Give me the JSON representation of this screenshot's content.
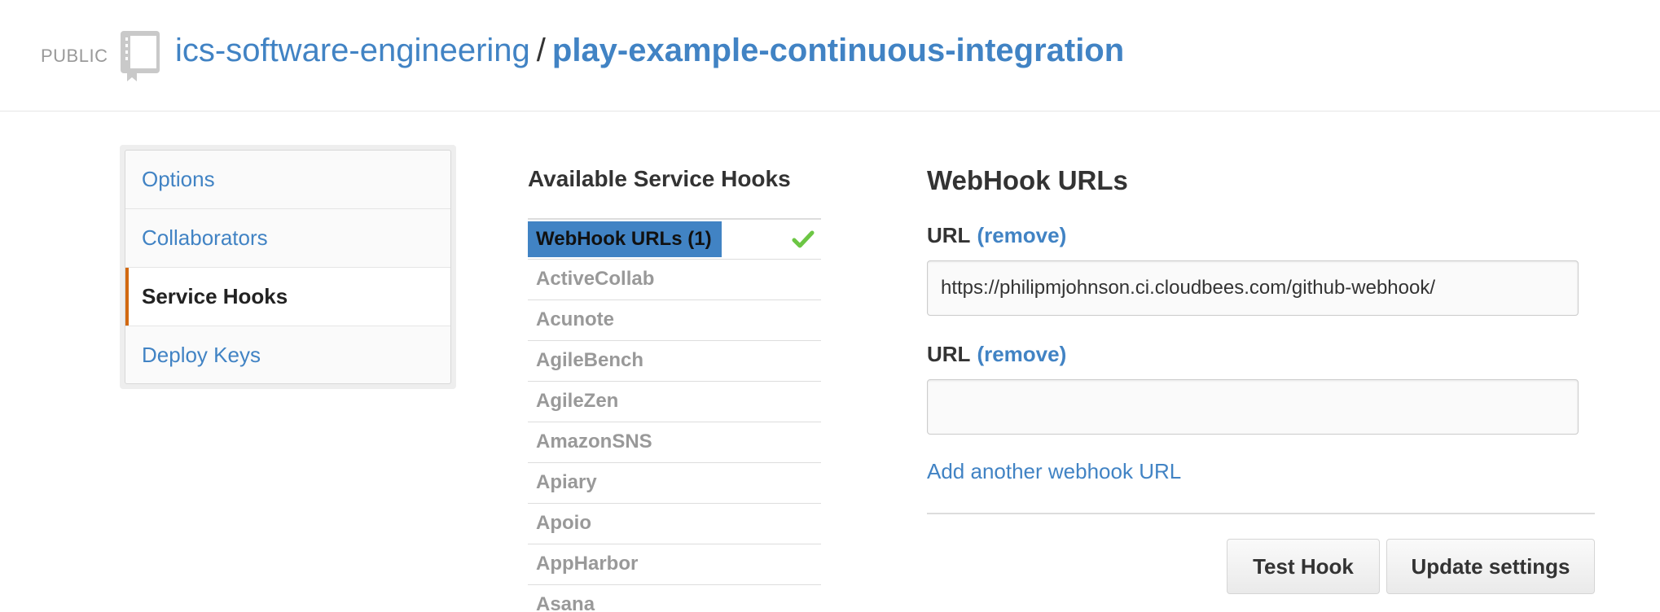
{
  "header": {
    "visibility": "PUBLIC",
    "owner": "ics-software-engineering",
    "separator": "/",
    "repo": "play-example-continuous-integration",
    "icon": "repo-book-icon"
  },
  "sidebar": {
    "items": [
      {
        "label": "Options",
        "selected": false
      },
      {
        "label": "Collaborators",
        "selected": false
      },
      {
        "label": "Service Hooks",
        "selected": true
      },
      {
        "label": "Deploy Keys",
        "selected": false
      }
    ],
    "accent_color": "#d26911"
  },
  "hooks": {
    "title": "Available Service Hooks",
    "items": [
      "WebHook URLs (1)",
      "ActiveCollab",
      "Acunote",
      "AgileBench",
      "AgileZen",
      "AmazonSNS",
      "Apiary",
      "Apoio",
      "AppHarbor",
      "Asana"
    ],
    "active_icon": "check-icon",
    "active_color": "#4183c4",
    "check_color": "#6cc644"
  },
  "panel": {
    "title": "WebHook URLs",
    "url_label": "URL",
    "remove_label": "(remove)",
    "urls": [
      "https://philipmjohnson.ci.cloudbees.com/github-webhook/",
      ""
    ],
    "add_link": "Add another webhook URL",
    "test_button": "Test Hook",
    "update_button": "Update settings"
  }
}
